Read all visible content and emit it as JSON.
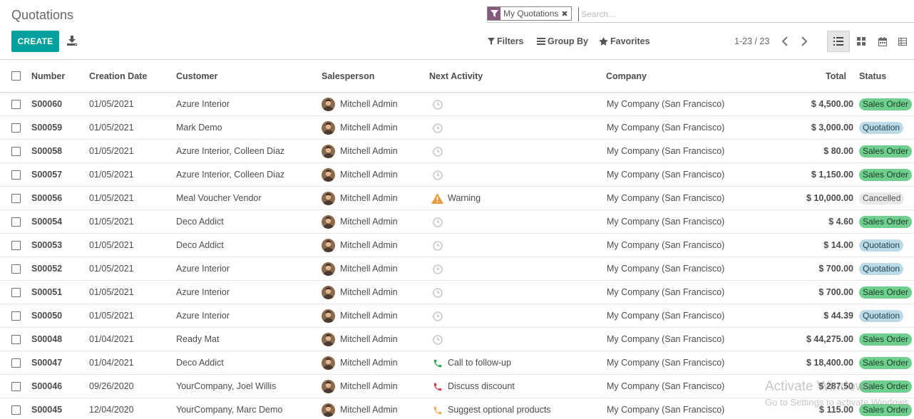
{
  "page": {
    "title": "Quotations"
  },
  "toolbar": {
    "create_label": "CREATE",
    "download_icon": "download-icon"
  },
  "search": {
    "facet_label": "My Quotations",
    "facet_icon": "filter-icon",
    "placeholder": "Search...",
    "filters_label": "Filters",
    "groupby_label": "Group By",
    "favorites_label": "Favorites"
  },
  "pager": {
    "text": "1-23 / 23"
  },
  "views": [
    "list-view-icon",
    "kanban-view-icon",
    "calendar-view-icon",
    "pivot-view-icon"
  ],
  "columns": {
    "number": "Number",
    "creation_date": "Creation Date",
    "customer": "Customer",
    "salesperson": "Salesperson",
    "next_activity": "Next Activity",
    "company": "Company",
    "total": "Total",
    "status": "Status"
  },
  "status_colors": {
    "Sales Order": {
      "bg": "#6fcf8f",
      "fg": "#1d3a26"
    },
    "Quotation": {
      "bg": "#bcd9e6",
      "fg": "#1f3f4d"
    },
    "Cancelled": {
      "bg": "#e9e9e9",
      "fg": "#555555"
    }
  },
  "rows": [
    {
      "number": "S00060",
      "date": "01/05/2021",
      "customer": "Azure Interior",
      "salesperson": "Mitchell Admin",
      "activity": "",
      "activity_icon": "clock-icon",
      "company": "My Company (San Francisco)",
      "total": "$ 4,500.00",
      "status": "Sales Order"
    },
    {
      "number": "S00059",
      "date": "01/05/2021",
      "customer": "Mark Demo",
      "salesperson": "Mitchell Admin",
      "activity": "",
      "activity_icon": "clock-icon",
      "company": "My Company (San Francisco)",
      "total": "$ 3,000.00",
      "status": "Quotation"
    },
    {
      "number": "S00058",
      "date": "01/05/2021",
      "customer": "Azure Interior, Colleen Diaz",
      "salesperson": "Mitchell Admin",
      "activity": "",
      "activity_icon": "clock-icon",
      "company": "My Company (San Francisco)",
      "total": "$ 80.00",
      "status": "Sales Order"
    },
    {
      "number": "S00057",
      "date": "01/05/2021",
      "customer": "Azure Interior, Colleen Diaz",
      "salesperson": "Mitchell Admin",
      "activity": "",
      "activity_icon": "clock-icon",
      "company": "My Company (San Francisco)",
      "total": "$ 1,150.00",
      "status": "Sales Order"
    },
    {
      "number": "S00056",
      "date": "01/05/2021",
      "customer": "Meal Voucher Vendor",
      "salesperson": "Mitchell Admin",
      "activity": "Warning",
      "activity_icon": "warning-icon",
      "company": "My Company (San Francisco)",
      "total": "$ 10,000.00",
      "status": "Cancelled"
    },
    {
      "number": "S00054",
      "date": "01/05/2021",
      "customer": "Deco Addict",
      "salesperson": "Mitchell Admin",
      "activity": "",
      "activity_icon": "clock-icon",
      "company": "My Company (San Francisco)",
      "total": "$ 4.60",
      "status": "Sales Order"
    },
    {
      "number": "S00053",
      "date": "01/05/2021",
      "customer": "Deco Addict",
      "salesperson": "Mitchell Admin",
      "activity": "",
      "activity_icon": "clock-icon",
      "company": "My Company (San Francisco)",
      "total": "$ 14.00",
      "status": "Quotation"
    },
    {
      "number": "S00052",
      "date": "01/05/2021",
      "customer": "Azure Interior",
      "salesperson": "Mitchell Admin",
      "activity": "",
      "activity_icon": "clock-icon",
      "company": "My Company (San Francisco)",
      "total": "$ 700.00",
      "status": "Quotation"
    },
    {
      "number": "S00051",
      "date": "01/05/2021",
      "customer": "Azure Interior",
      "salesperson": "Mitchell Admin",
      "activity": "",
      "activity_icon": "clock-icon",
      "company": "My Company (San Francisco)",
      "total": "$ 700.00",
      "status": "Sales Order"
    },
    {
      "number": "S00050",
      "date": "01/05/2021",
      "customer": "Azure Interior",
      "salesperson": "Mitchell Admin",
      "activity": "",
      "activity_icon": "clock-icon",
      "company": "My Company (San Francisco)",
      "total": "$ 44.39",
      "status": "Quotation"
    },
    {
      "number": "S00048",
      "date": "01/04/2021",
      "customer": "Ready Mat",
      "salesperson": "Mitchell Admin",
      "activity": "",
      "activity_icon": "clock-icon",
      "company": "My Company (San Francisco)",
      "total": "$ 44,275.00",
      "status": "Sales Order"
    },
    {
      "number": "S00047",
      "date": "01/04/2021",
      "customer": "Deco Addict",
      "salesperson": "Mitchell Admin",
      "activity": "Call to follow-up",
      "activity_icon": "phone-icon-green",
      "company": "My Company (San Francisco)",
      "total": "$ 18,400.00",
      "status": "Sales Order"
    },
    {
      "number": "S00046",
      "date": "09/26/2020",
      "customer": "YourCompany, Joel Willis",
      "salesperson": "Mitchell Admin",
      "activity": "Discuss discount",
      "activity_icon": "phone-icon-red",
      "company": "My Company (San Francisco)",
      "total": "$ 287.50",
      "status": "Sales Order"
    },
    {
      "number": "S00045",
      "date": "12/04/2020",
      "customer": "YourCompany, Marc Demo",
      "salesperson": "Mitchell Admin",
      "activity": "Suggest optional products",
      "activity_icon": "phone-icon-orange",
      "company": "My Company (San Francisco)",
      "total": "$ 115.00",
      "status": "Sales Order"
    }
  ],
  "watermark": {
    "line1": "Activate Windows",
    "line2": "Go to Settings to activate Windows."
  }
}
